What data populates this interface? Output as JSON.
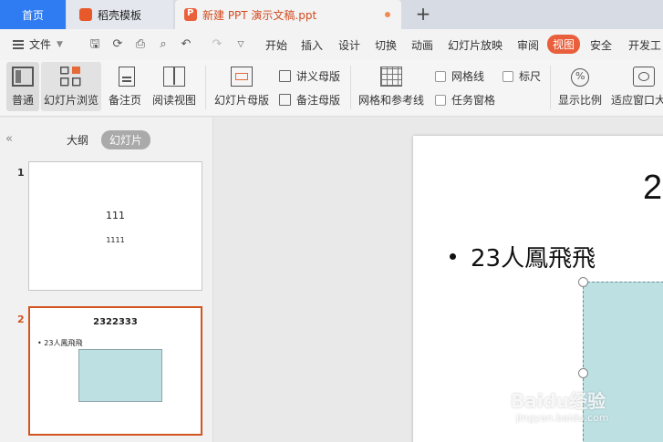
{
  "tabs": {
    "home": "首页",
    "template": "稻壳模板",
    "document": "新建 PPT 演示文稿.ppt",
    "new_tab_symbol": "+"
  },
  "menu": {
    "file": "文件",
    "items": [
      "开始",
      "插入",
      "设计",
      "切换",
      "动画",
      "幻灯片放映",
      "审阅",
      "视图",
      "安全",
      "开发工"
    ],
    "active": "视图"
  },
  "ribbon": {
    "normal": "普通",
    "sorter": "幻灯片浏览",
    "notes_page": "备注页",
    "reading_view": "阅读视图",
    "slide_master": "幻灯片母版",
    "handout_master": "讲义母版",
    "notes_master": "备注母版",
    "grid_guides": "网格和参考线",
    "gridlines": "网格线",
    "ruler": "标尺",
    "task_pane": "任务窗格",
    "zoom": "显示比例",
    "fit_window": "适应窗口大"
  },
  "panel": {
    "tab_outline": "大纲",
    "tab_slides": "幻灯片",
    "collapse_symbol": "«"
  },
  "thumbnails": [
    {
      "number": "1",
      "title": "111",
      "subtitle": "1111"
    },
    {
      "number": "2",
      "title": "2322333",
      "bullet": "• 23人鳳飛飛"
    }
  ],
  "slide": {
    "title_partial": "2",
    "bullet": "23人鳳飛飛"
  },
  "watermark": {
    "text": "Baidu经验",
    "url": "jingyan.baidu.com"
  },
  "colors": {
    "accent_blue": "#2f7bf2",
    "accent_orange": "#e95f3c",
    "shape_fill": "#bde0e3"
  }
}
